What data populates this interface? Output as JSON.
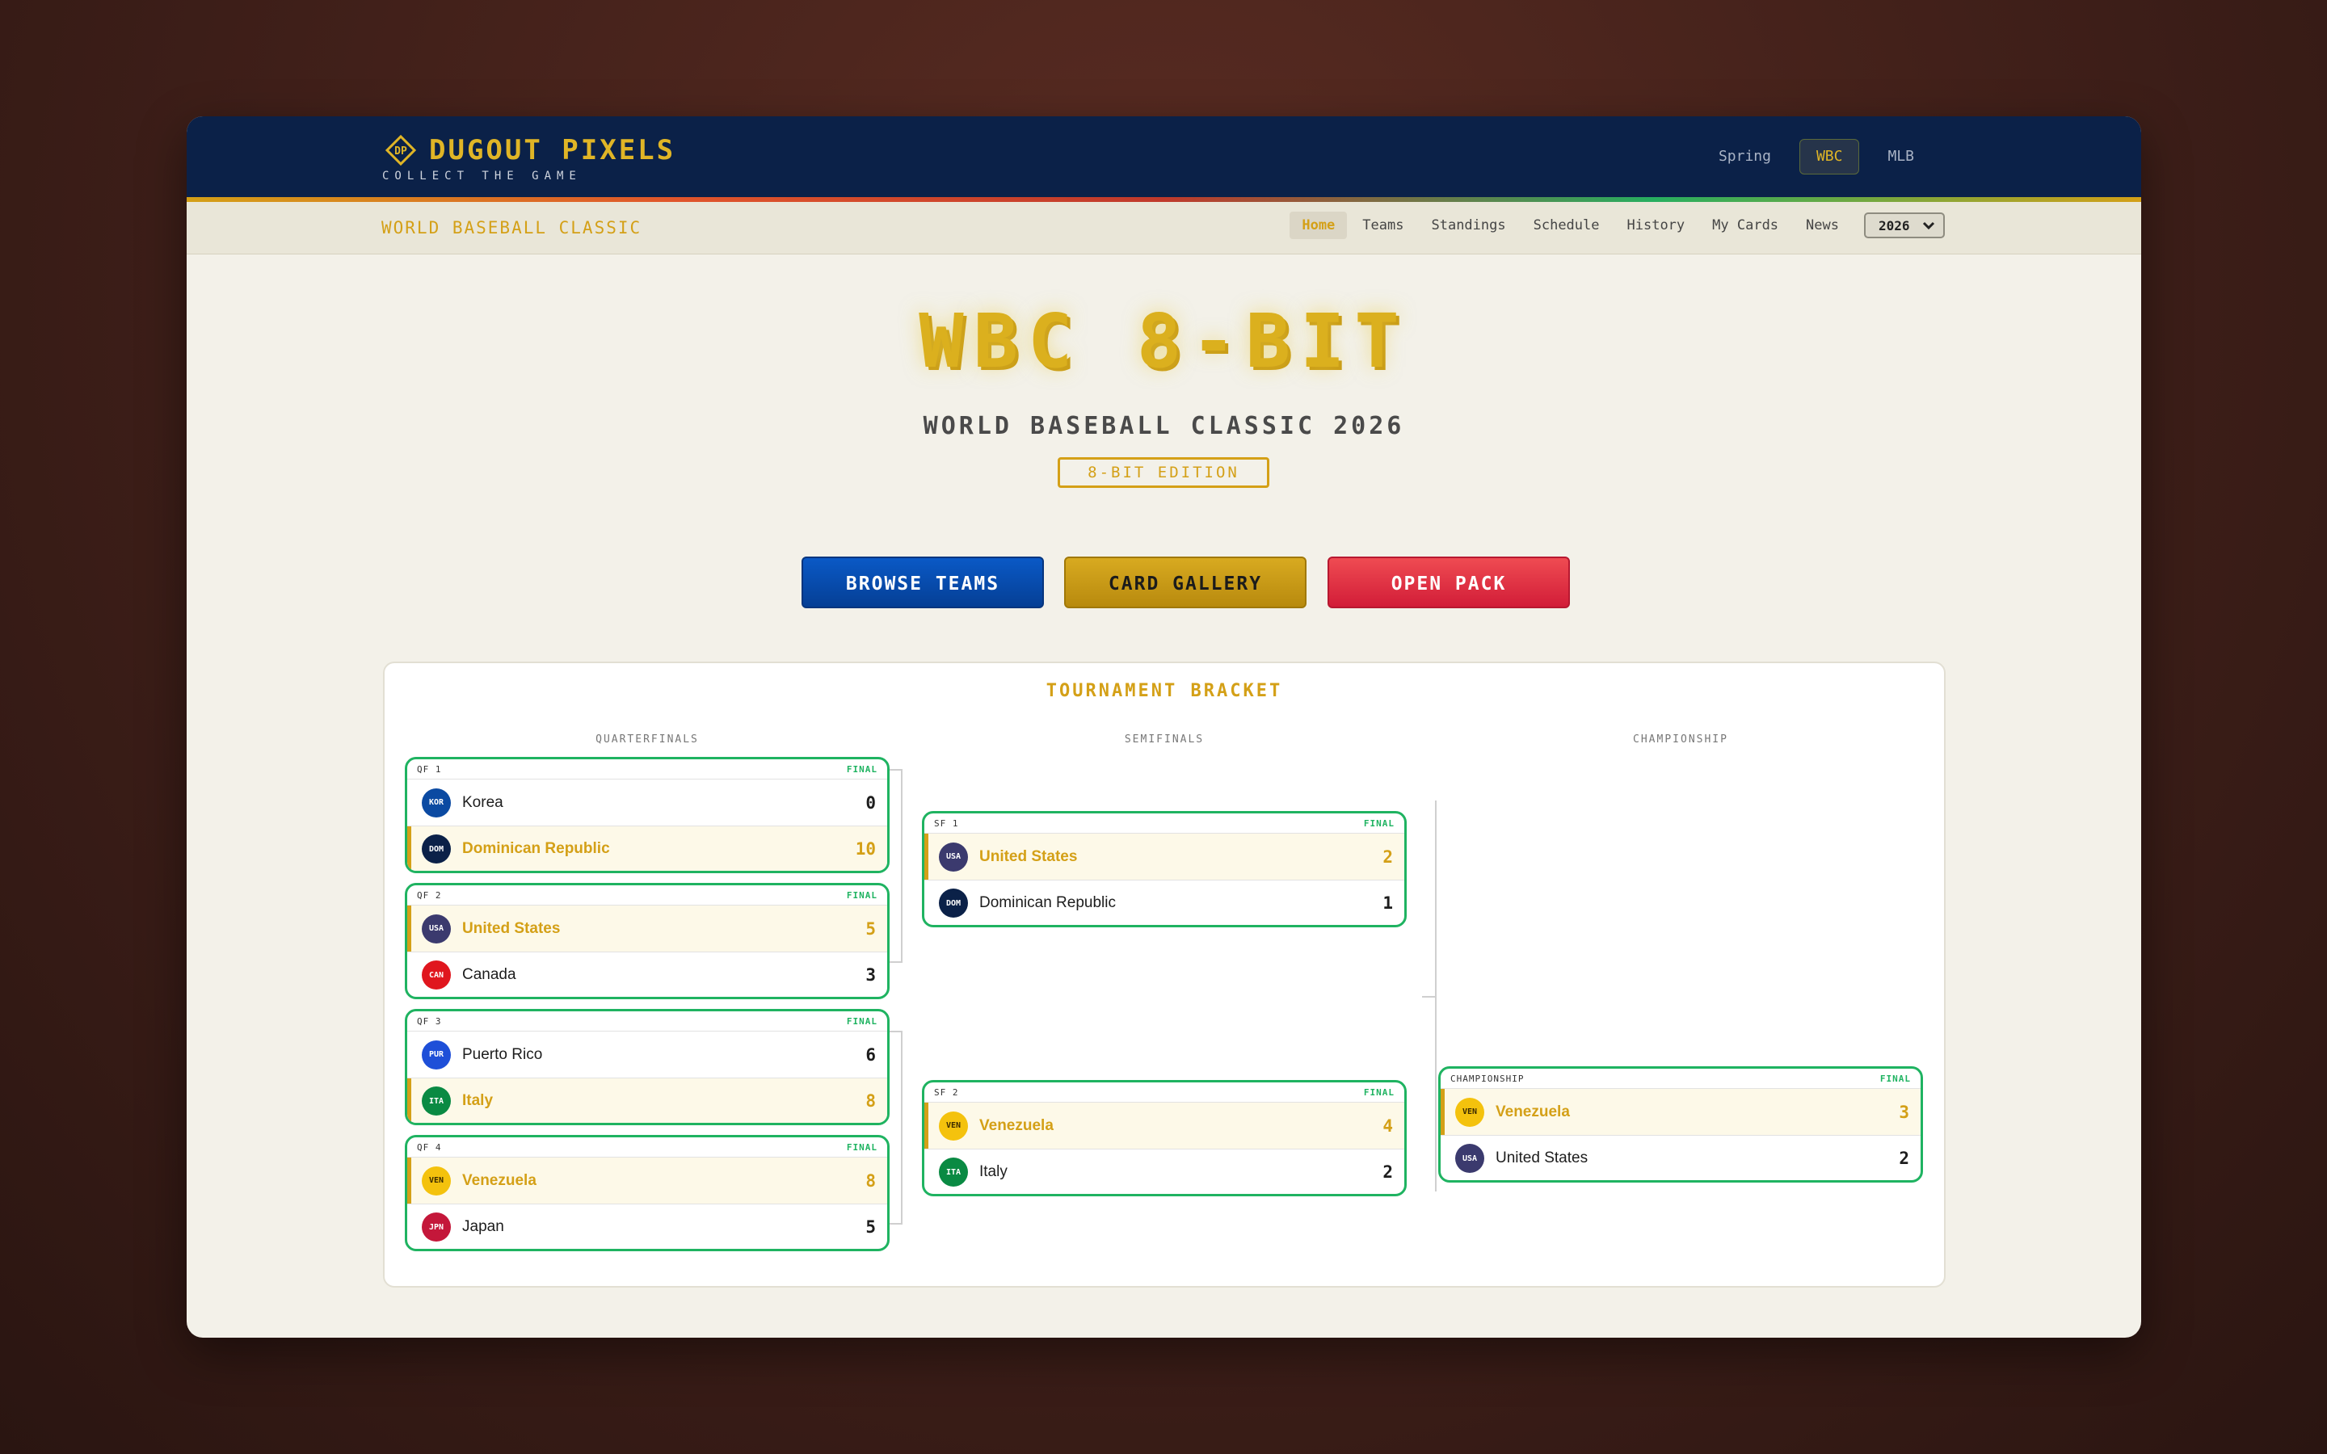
{
  "brand": {
    "badge": "DP",
    "name": "DUGOUT PIXELS",
    "tagline": "COLLECT THE GAME"
  },
  "league_tabs": [
    {
      "label": "Spring",
      "active": false
    },
    {
      "label": "WBC",
      "active": true
    },
    {
      "label": "MLB",
      "active": false
    }
  ],
  "subnav": {
    "title": "WORLD BASEBALL CLASSIC",
    "links": [
      "Home",
      "Teams",
      "Standings",
      "Schedule",
      "History",
      "My Cards",
      "News"
    ],
    "active": "Home",
    "year": "2026"
  },
  "hero": {
    "title": "WBC 8-BIT",
    "subtitle": "WORLD BASEBALL CLASSIC 2026",
    "edition": "8-BIT EDITION"
  },
  "actions": {
    "browse": "BROWSE TEAMS",
    "gallery": "CARD GALLERY",
    "pack": "OPEN PACK"
  },
  "bracket": {
    "title": "TOURNAMENT BRACKET",
    "columns": [
      "QUARTERFINALS",
      "SEMIFINALS",
      "CHAMPIONSHIP"
    ],
    "quarterfinals": [
      {
        "label": "QF 1",
        "status": "FINAL",
        "teams": [
          {
            "code": "KOR",
            "name": "Korea",
            "score": "0",
            "win": false,
            "color": "#0b4aa2"
          },
          {
            "code": "DOM",
            "name": "Dominican Republic",
            "score": "10",
            "win": true,
            "color": "#0b2148"
          }
        ]
      },
      {
        "label": "QF 2",
        "status": "FINAL",
        "teams": [
          {
            "code": "USA",
            "name": "United States",
            "score": "5",
            "win": true,
            "color": "#3b3a6e"
          },
          {
            "code": "CAN",
            "name": "Canada",
            "score": "3",
            "win": false,
            "color": "#e0161e"
          }
        ]
      },
      {
        "label": "QF 3",
        "status": "FINAL",
        "teams": [
          {
            "code": "PUR",
            "name": "Puerto Rico",
            "score": "6",
            "win": false,
            "color": "#1e4fd8"
          },
          {
            "code": "ITA",
            "name": "Italy",
            "score": "8",
            "win": true,
            "color": "#0a8a43"
          }
        ]
      },
      {
        "label": "QF 4",
        "status": "FINAL",
        "teams": [
          {
            "code": "VEN",
            "name": "Venezuela",
            "score": "8",
            "win": true,
            "color": "#f4c20d"
          },
          {
            "code": "JPN",
            "name": "Japan",
            "score": "5",
            "win": false,
            "color": "#c4173a"
          }
        ]
      }
    ],
    "semifinals": [
      {
        "label": "SF 1",
        "status": "FINAL",
        "teams": [
          {
            "code": "USA",
            "name": "United States",
            "score": "2",
            "win": true,
            "color": "#3b3a6e"
          },
          {
            "code": "DOM",
            "name": "Dominican Republic",
            "score": "1",
            "win": false,
            "color": "#0b2148"
          }
        ]
      },
      {
        "label": "SF 2",
        "status": "FINAL",
        "teams": [
          {
            "code": "VEN",
            "name": "Venezuela",
            "score": "4",
            "win": true,
            "color": "#f4c20d"
          },
          {
            "code": "ITA",
            "name": "Italy",
            "score": "2",
            "win": false,
            "color": "#0a8a43"
          }
        ]
      }
    ],
    "championship": [
      {
        "label": "CHAMPIONSHIP",
        "status": "FINAL",
        "teams": [
          {
            "code": "VEN",
            "name": "Venezuela",
            "score": "3",
            "win": true,
            "color": "#f4c20d"
          },
          {
            "code": "USA",
            "name": "United States",
            "score": "2",
            "win": false,
            "color": "#3b3a6e"
          }
        ]
      }
    ]
  }
}
